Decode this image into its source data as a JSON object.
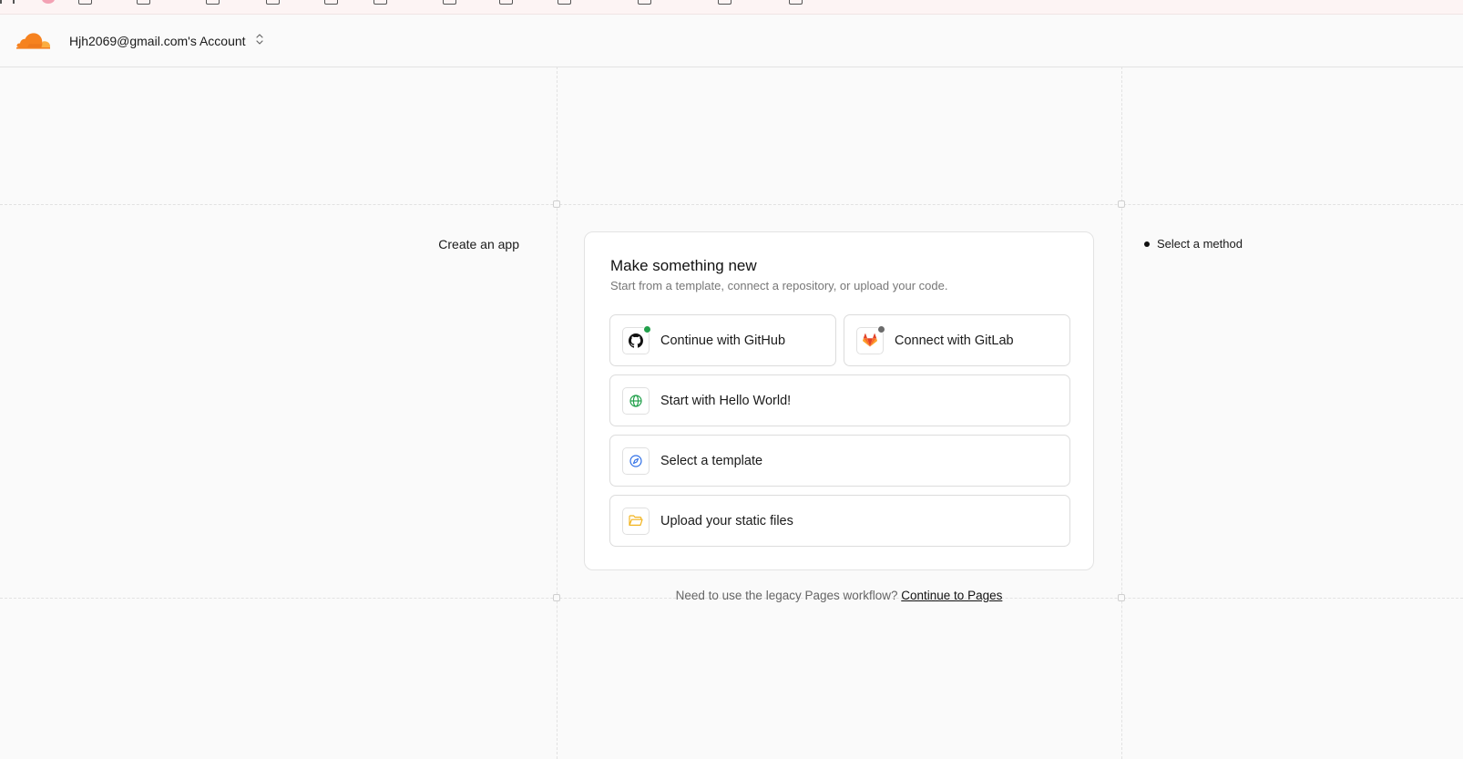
{
  "header": {
    "account_name": "Hjh2069@gmail.com's Account"
  },
  "icons": {
    "logo": "cloudflare-logo",
    "account_switch": "chevron-up-down-icon",
    "github": "github-icon",
    "gitlab": "gitlab-icon",
    "hello_world": "globe-icon",
    "template": "compass-icon",
    "upload": "folder-icon"
  },
  "steps": {
    "page_title": "Create an app",
    "items": [
      {
        "label": "Select a method"
      }
    ]
  },
  "card": {
    "title": "Make something new",
    "subtitle": "Start from a template, connect a repository, or upload your code.",
    "options": [
      {
        "label": "Continue with GitHub",
        "status_color": "#22a04b"
      },
      {
        "label": "Connect with GitLab",
        "status_color": "#6b6b6b"
      },
      {
        "label": "Start with Hello World!"
      },
      {
        "label": "Select a template"
      },
      {
        "label": "Upload your static files"
      }
    ]
  },
  "legacy": {
    "prompt": "Need to use the legacy Pages workflow?",
    "link_label": "Continue to Pages"
  },
  "colors": {
    "brand_orange": "#f38020",
    "hello_world_green": "#22a04b",
    "template_blue": "#2f6fe6",
    "folder_yellow": "#f2b41f",
    "gitlab_orange": "#e24329"
  }
}
